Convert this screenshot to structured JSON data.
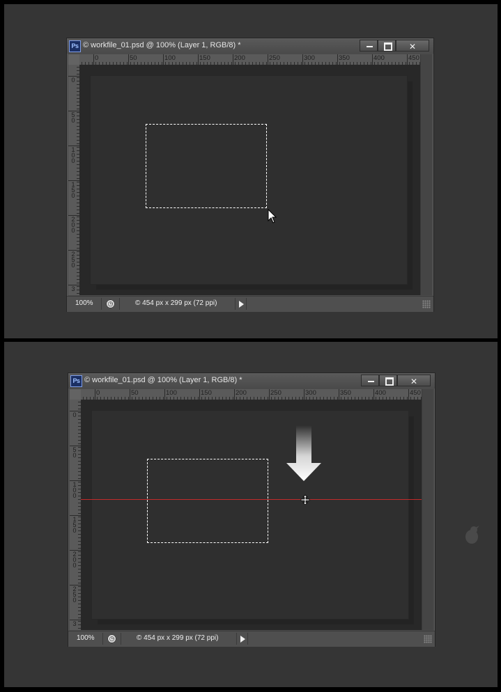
{
  "windows": [
    {
      "title": "© workfile_01.psd @ 100% (Layer 1, RGB/8) *",
      "logo": "Ps",
      "ruler_h_labels": [
        "0",
        "50",
        "100",
        "150",
        "200",
        "250",
        "300",
        "350",
        "400",
        "450"
      ],
      "ruler_v_labels": [
        "0",
        "50",
        "100",
        "150",
        "200",
        "250",
        "3"
      ],
      "zoom": "100%",
      "doc_info": "© 454 px x 299 px (72 ppi)"
    },
    {
      "title": "© workfile_01.psd @ 100% (Layer 1, RGB/8) *",
      "logo": "Ps",
      "ruler_h_labels": [
        "0",
        "50",
        "100",
        "150",
        "200",
        "250",
        "300",
        "350",
        "400",
        "450"
      ],
      "ruler_v_labels": [
        "0",
        "50",
        "100",
        "150",
        "200",
        "250",
        "3"
      ],
      "zoom": "100%",
      "doc_info": "© 454 px x 299 px (72 ppi)"
    }
  ],
  "icons": {
    "minimize": "minimize-icon",
    "maximize": "maximize-icon",
    "close": "close-icon",
    "status": "status-clock-icon",
    "menu_arrow": "play-icon",
    "resize": "resize-grip-icon",
    "pointer": "arrow-cursor-icon",
    "guide_move": "move-guide-cursor-icon",
    "down_arrow": "down-arrow-icon",
    "bug": "bug-icon"
  },
  "colors": {
    "background": "#353535",
    "guide_line": "#c22a2a",
    "marquee": "#ffffff"
  }
}
